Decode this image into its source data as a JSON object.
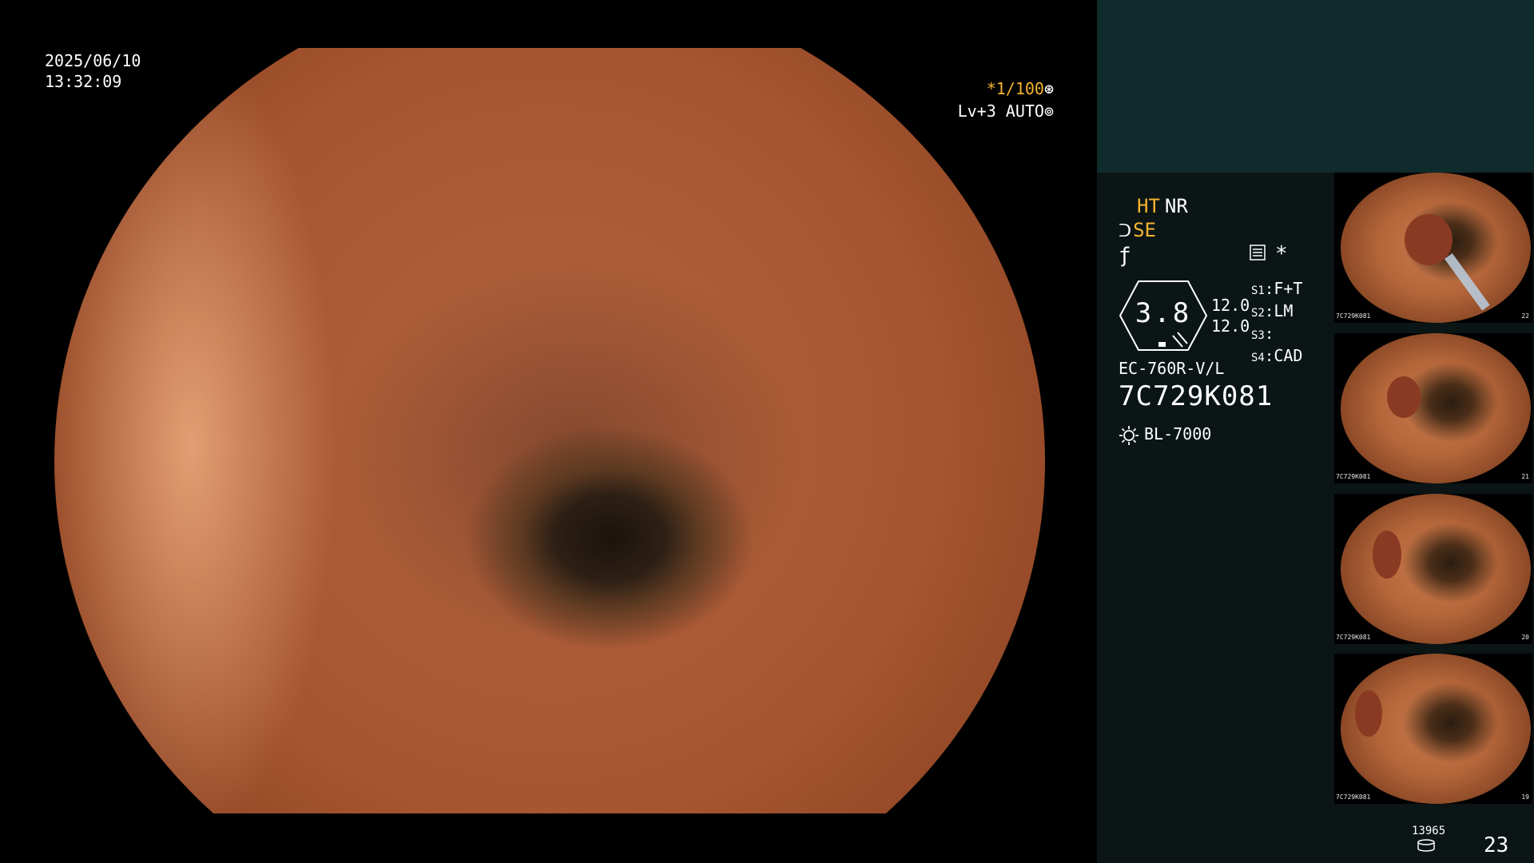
{
  "overlay": {
    "date": "2025/06/10",
    "time": "13:32:09",
    "shutter": "*1/100",
    "iris": "Lv+3 AUTO"
  },
  "info": {
    "ht": "HT",
    "nr": "NR",
    "se": "SE",
    "zoom": "3.8",
    "zoom_sub1": "12.0",
    "zoom_sub2": "12.0",
    "s_items": [
      {
        "key": "S1",
        "value": "F+T"
      },
      {
        "key": "S2",
        "value": "LM"
      },
      {
        "key": "S3",
        "value": ""
      },
      {
        "key": "S4",
        "value": "CAD"
      }
    ],
    "scope_model": "EC-760R-V/L",
    "serial": "7C729K081",
    "light_source": "BL-7000"
  },
  "footer": {
    "counter": "13965",
    "page_number": "23"
  },
  "thumbnails": [
    {
      "num": "22",
      "meta_id": "7C729K081"
    },
    {
      "num": "21",
      "meta_id": "7C729K081"
    },
    {
      "num": "20",
      "meta_id": "7C729K081"
    },
    {
      "num": "19",
      "meta_id": "7C729K081"
    }
  ],
  "colors": {
    "accent": "#f5b431",
    "panel_bg": "#0b1515",
    "panel_top": "#102b2b"
  }
}
